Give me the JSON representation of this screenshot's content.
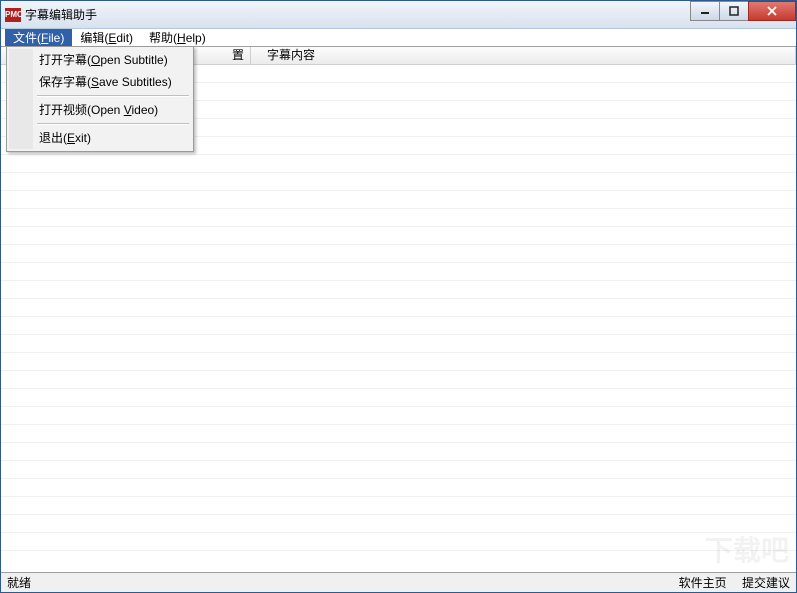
{
  "window": {
    "icon_text": "PMC",
    "title": "字幕编辑助手"
  },
  "menubar": {
    "file": "文件(File)",
    "edit": "编辑(Edit)",
    "help": "帮助(Help)"
  },
  "dropdown": {
    "open_subtitle_pre": "打开字幕(",
    "open_subtitle_u": "O",
    "open_subtitle_post": "pen Subtitle)",
    "save_subtitles_pre": "保存字幕(",
    "save_subtitles_u": "S",
    "save_subtitles_post": "ave Subtitles)",
    "open_video_pre": "打开视频(Open ",
    "open_video_u": "V",
    "open_video_post": "ideo)",
    "exit_pre": "退出(",
    "exit_u": "E",
    "exit_post": "xit)"
  },
  "columns": {
    "col2_tail": "置",
    "col3": "字幕内容"
  },
  "statusbar": {
    "ready": "就绪",
    "homepage": "软件主页",
    "feedback": "提交建议"
  },
  "watermark": "下载吧"
}
